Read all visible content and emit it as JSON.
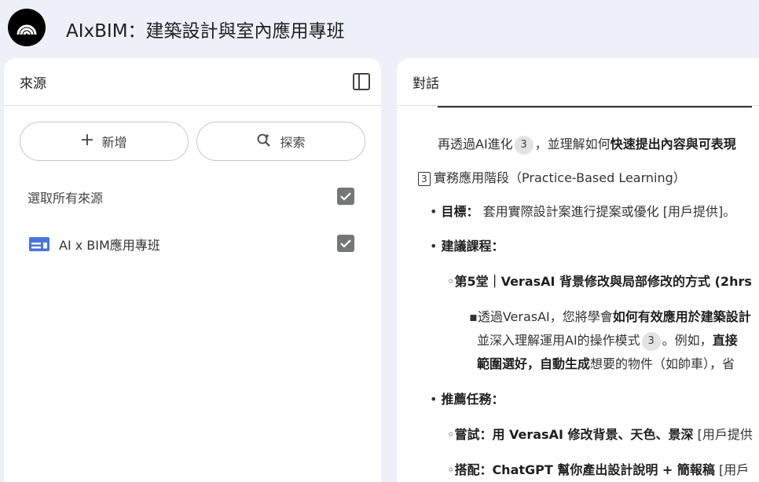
{
  "app": {
    "title": "AIxBIM：建築設計與室內應用專班",
    "logo_icon": "notebook-waves-icon"
  },
  "sources_panel": {
    "title": "來源",
    "toggle_icon": "panel-toggle-icon",
    "add_button": {
      "icon": "plus-icon",
      "label": "新增"
    },
    "explore_button": {
      "icon": "sparkle-search-icon",
      "label": "探索"
    },
    "select_all": {
      "label": "選取所有來源",
      "checked": true
    },
    "items": [
      {
        "icon": "web-page-icon",
        "label": "AI x BIM應用專班",
        "checked": true
      }
    ]
  },
  "chat_panel": {
    "title": "對話",
    "content": {
      "l0_text": "再透過AI進化",
      "l0_cite": "3",
      "l0_rest": "，並理解如何",
      "l0_bold": "快速提出內容與可表現",
      "section_number": "3",
      "section_title": "實務應用階段（Practice-Based Learning）",
      "goal_bullet": "•",
      "goal_label": "目標：",
      "goal_text": " 套用實際設計案進行提案或優化 [用戶提供]。",
      "courses_bullet": "•",
      "courses_label": "建議課程：",
      "course5_bullet": "◦",
      "course5_title": "第5堂｜VerasAI 背景修改與局部修改的方式 (2hrs",
      "detail_bullet": "▪",
      "detail_a": "透過VerasAI，您將學會",
      "detail_a_bold": "如何有效應用於建築設計",
      "detail_b": "並深入理解運用AI的操作模式",
      "detail_b_cite": "3",
      "detail_b_rest": "。例如，",
      "detail_b_bold": "直接",
      "detail_c_bold": "範圍選好，自動生成",
      "detail_c": "想要的物件（如帥車），省",
      "tasks_bullet": "•",
      "tasks_label": "推薦任務：",
      "task1_bullet": "◦",
      "task1_bold": "嘗試：用 VerasAI 修改背景、天色、景深",
      "task1_rest": " [用戶提供",
      "task2_bullet": "◦",
      "task2_bold": "搭配：ChatGPT 幫你產出設計說明 + 簡報稿",
      "task2_rest": " [用戶"
    }
  }
}
